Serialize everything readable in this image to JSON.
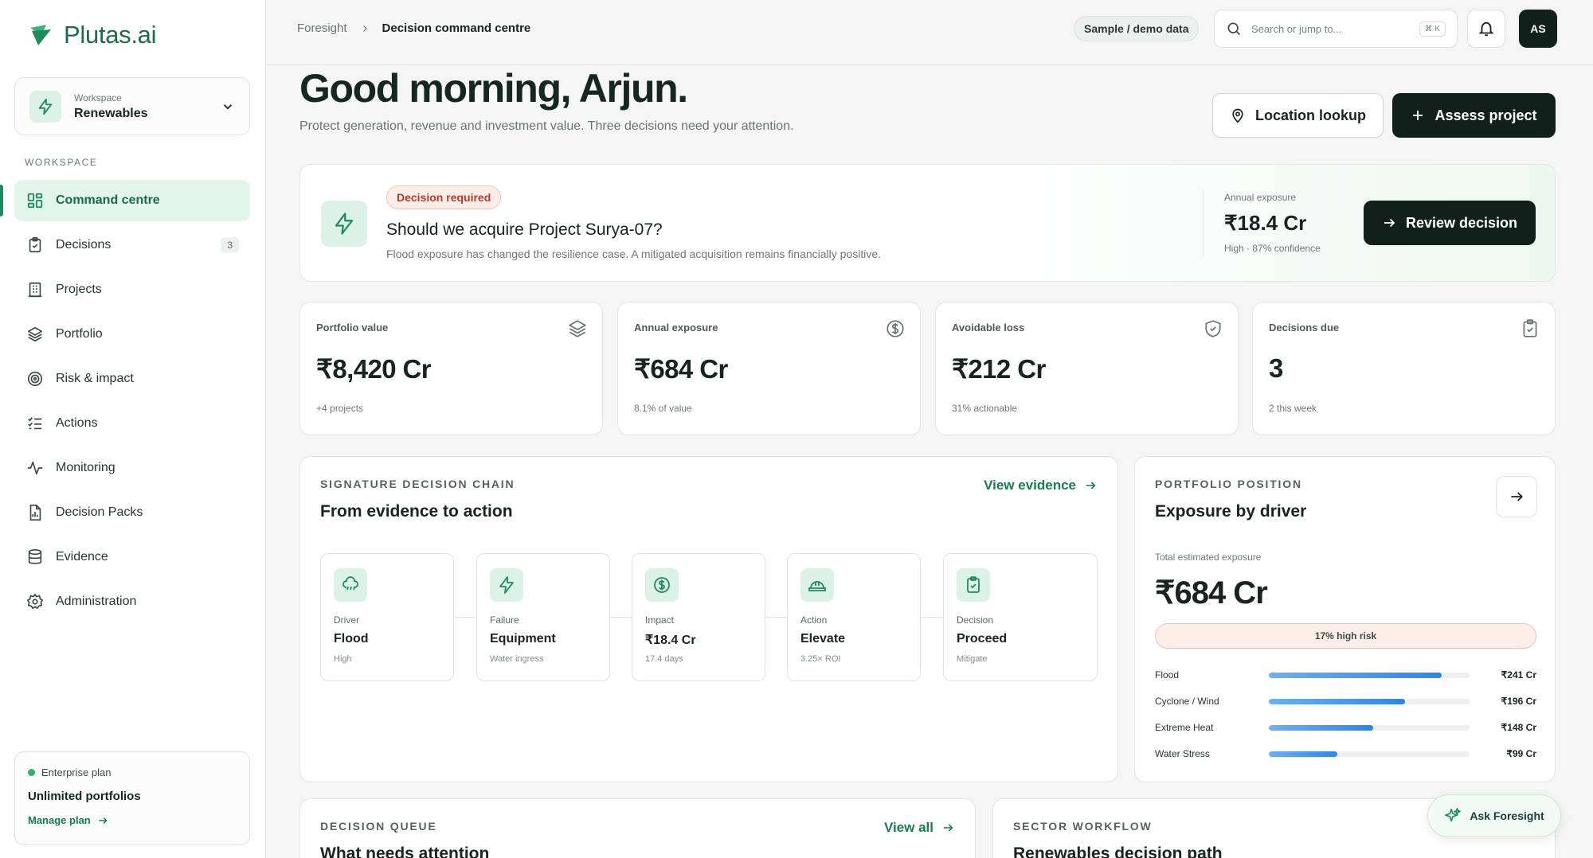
{
  "brand": {
    "name": "Plutas.ai",
    "color": "#1f6b4a"
  },
  "workspace": {
    "label": "Workspace",
    "name": "Renewables"
  },
  "sidebar": {
    "section": "WORKSPACE",
    "items": [
      {
        "label": "Command centre",
        "icon": "grid-icon",
        "active": true
      },
      {
        "label": "Decisions",
        "icon": "clipboard-icon",
        "badge": "3"
      },
      {
        "label": "Projects",
        "icon": "building-icon"
      },
      {
        "label": "Portfolio",
        "icon": "layers-icon"
      },
      {
        "label": "Risk & impact",
        "icon": "target-icon"
      },
      {
        "label": "Actions",
        "icon": "checklist-icon"
      },
      {
        "label": "Monitoring",
        "icon": "pulse-icon"
      },
      {
        "label": "Decision Packs",
        "icon": "report-icon"
      },
      {
        "label": "Evidence",
        "icon": "database-icon"
      },
      {
        "label": "Administration",
        "icon": "gear-icon"
      }
    ]
  },
  "plan": {
    "status": "Enterprise plan",
    "name": "Unlimited portfolios",
    "link": "Manage plan"
  },
  "topbar": {
    "breadcrumb": [
      "Foresight",
      "Decision command centre"
    ],
    "sample_label": "Sample / demo data",
    "search_placeholder": "Search or jump to...",
    "shortcut": "⌘ K",
    "avatar": "AS"
  },
  "header": {
    "greeting": "Good morning, Arjun.",
    "subtitle": "Protect generation, revenue and investment value. Three decisions need your attention.",
    "location_button": "Location lookup",
    "assess_button": "Assess project"
  },
  "decision": {
    "badge": "Decision required",
    "question": "Should we acquire Project Surya-07?",
    "description": "Flood exposure has changed the resilience case. A mitigated acquisition remains financially positive.",
    "exposure_label": "Annual exposure",
    "exposure_value": "₹18.4 Cr",
    "confidence": "High · 87% confidence",
    "review_button": "Review decision"
  },
  "kpis": [
    {
      "label": "Portfolio value",
      "value": "₹8,420 Cr",
      "sub": "+4 projects",
      "icon": "layers-icon"
    },
    {
      "label": "Annual exposure",
      "value": "₹684 Cr",
      "sub": "8.1% of value",
      "icon": "dollar-circle-icon"
    },
    {
      "label": "Avoidable loss",
      "value": "₹212 Cr",
      "sub": "31% actionable",
      "icon": "shield-check-icon"
    },
    {
      "label": "Decisions due",
      "value": "3",
      "sub": "2 this week",
      "icon": "clipboard-check-icon"
    }
  ],
  "chain": {
    "eyebrow": "SIGNATURE DECISION CHAIN",
    "title": "From evidence to action",
    "link": "View evidence",
    "steps": [
      {
        "label": "Driver",
        "value": "Flood",
        "sub": "High",
        "icon": "cloud-rain-icon"
      },
      {
        "label": "Failure",
        "value": "Equipment",
        "sub": "Water ingress",
        "icon": "bolt-icon"
      },
      {
        "label": "Impact",
        "value": "₹18.4 Cr",
        "sub": "17.4 days",
        "icon": "dollar-circle-icon"
      },
      {
        "label": "Action",
        "value": "Elevate",
        "sub": "3.25× ROI",
        "icon": "hard-hat-icon"
      },
      {
        "label": "Decision",
        "value": "Proceed",
        "sub": "Mitigate",
        "icon": "clipboard-check-icon"
      }
    ]
  },
  "portfolio": {
    "eyebrow": "PORTFOLIO POSITION",
    "title": "Exposure by driver",
    "total_label": "Total estimated exposure",
    "total_value": "₹684 Cr",
    "risk_pill": "17% high risk",
    "drivers": [
      {
        "name": "Flood",
        "value": "₹241 Cr",
        "fraction": 0.86
      },
      {
        "name": "Cyclone / Wind",
        "value": "₹196 Cr",
        "fraction": 0.68
      },
      {
        "name": "Extreme Heat",
        "value": "₹148 Cr",
        "fraction": 0.52
      },
      {
        "name": "Water Stress",
        "value": "₹99 Cr",
        "fraction": 0.34
      }
    ]
  },
  "queue": {
    "eyebrow": "DECISION QUEUE",
    "title": "What needs attention",
    "link": "View all"
  },
  "sector": {
    "eyebrow": "SECTOR WORKFLOW",
    "title": "Renewables decision path"
  },
  "assistant": {
    "label": "Ask Foresight"
  },
  "colors": {
    "accent": "#1f8a5b",
    "dark": "#12201b",
    "danger": "#b53a2b",
    "bar": "#2f86e0"
  }
}
